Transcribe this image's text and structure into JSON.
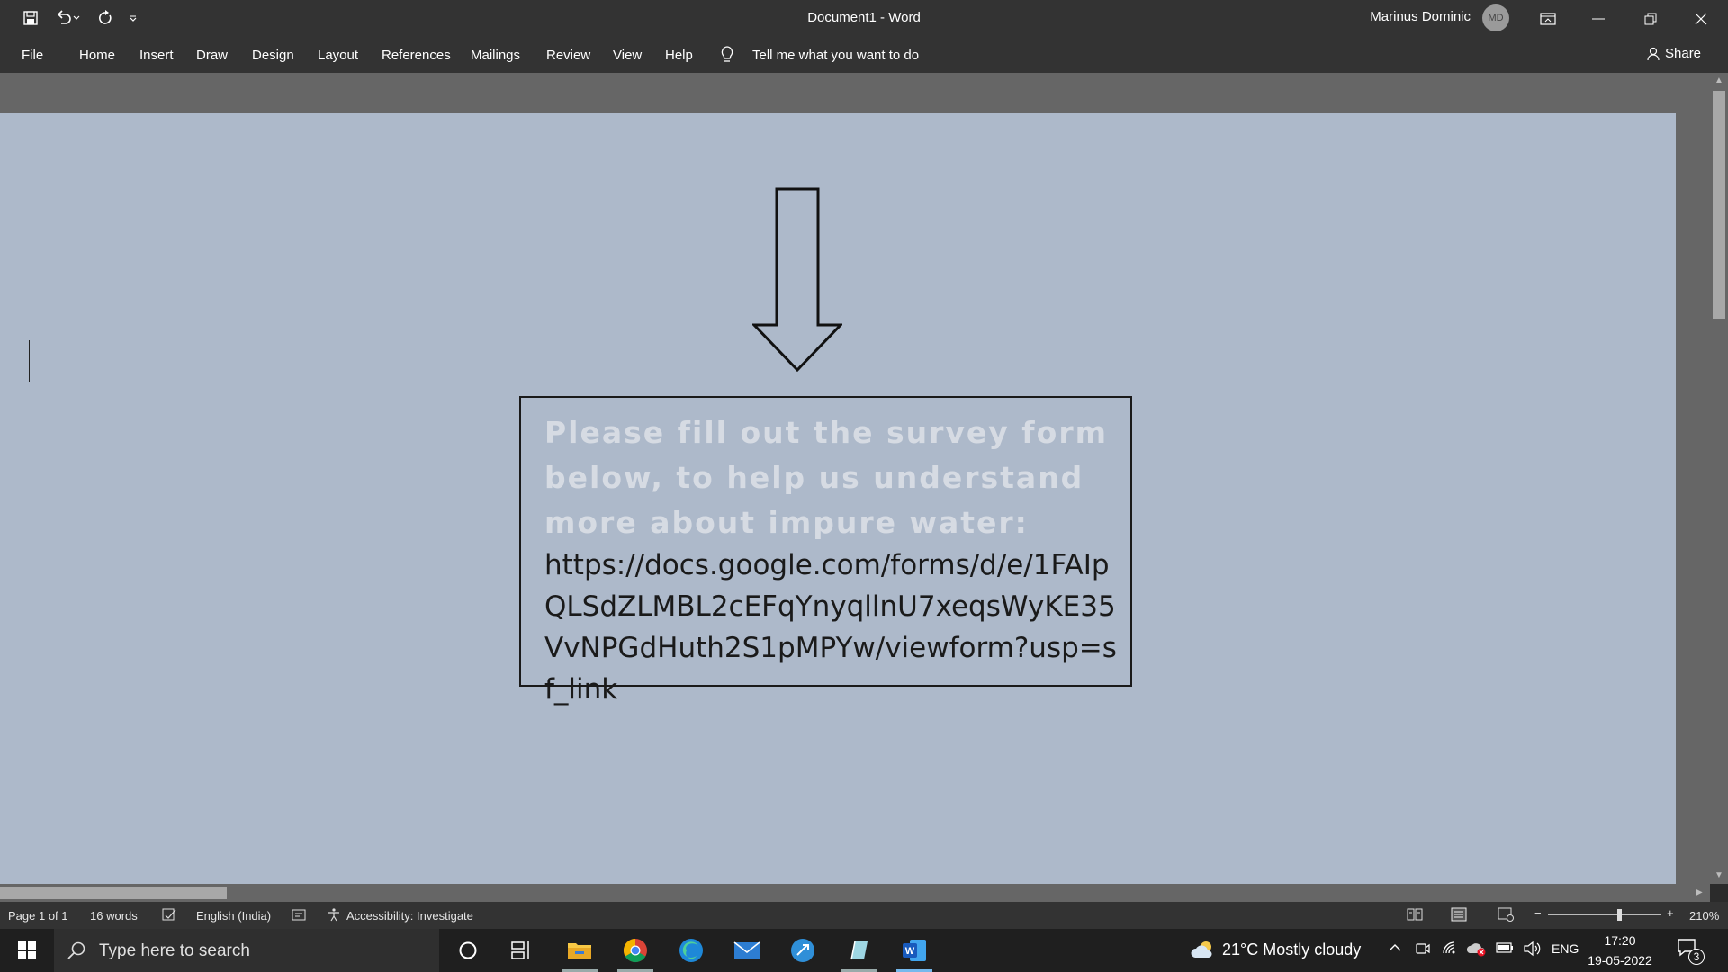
{
  "window": {
    "title": "Document1  -  Word",
    "user": "Marinus Dominic",
    "avatar_initials": "MD"
  },
  "ribbon": {
    "tabs": [
      "File",
      "Home",
      "Insert",
      "Draw",
      "Design",
      "Layout",
      "References",
      "Mailings",
      "Review",
      "View",
      "Help"
    ],
    "tell_me": "Tell me what you want to do",
    "share": "Share"
  },
  "document": {
    "heading": "Please fill out the survey form below, to help us understand more about impure water:",
    "link": "https://docs.google.com/forms/d/e/1FAIpQLSdZLMBL2cEFqYnyqllnU7xeqsWyKE35VvNPGdHuth2S1pMPYw/viewform?usp=sf_link"
  },
  "statusbar": {
    "page": "Page 1 of 1",
    "words": "16 words",
    "language": "English (India)",
    "accessibility": "Accessibility: Investigate",
    "zoom": "210%",
    "zoom_minus": "−",
    "zoom_plus": "+"
  },
  "taskbar": {
    "search_placeholder": "Type here to search",
    "weather": "21°C  Mostly cloudy",
    "language": "ENG",
    "time": "17:20",
    "date": "19-05-2022",
    "notifications": "3"
  },
  "colors": {
    "chrome": "#333333",
    "page": "#adb9ca",
    "canvas": "#666666",
    "taskbar": "#1f1f1f",
    "word_blue": "#185abd"
  }
}
